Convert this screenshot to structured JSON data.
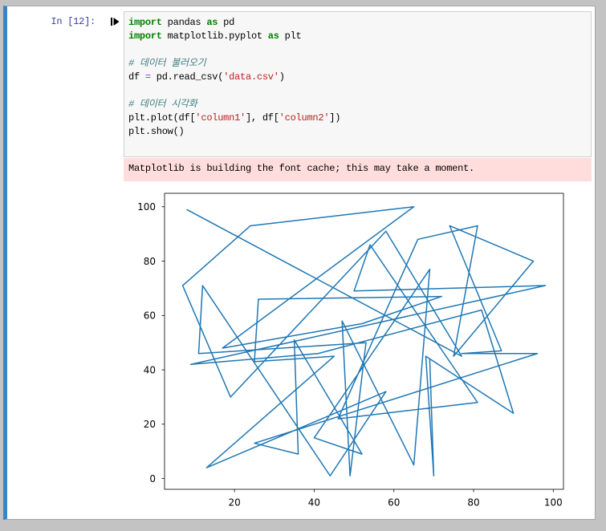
{
  "cell": {
    "prompt": "In [12]:",
    "code_lines": [
      [
        "import",
        " pandas ",
        "as",
        " pd"
      ],
      [
        "import",
        " matplotlib.pyplot ",
        "as",
        " plt"
      ],
      [],
      [
        "# 데이터 불러오기"
      ],
      [
        "df ",
        "=",
        " pd.read_csv(",
        "'data.csv'",
        ")"
      ],
      [],
      [
        "# 데이터 시각화"
      ],
      [
        "plt.plot(df[",
        "'column1'",
        "], df[",
        "'column2'",
        "])"
      ],
      [
        "plt.show()"
      ]
    ],
    "stderr": "Matplotlib is building the font cache; this may take a moment."
  },
  "icons": {
    "run_cell": "run-cell-icon"
  },
  "colors": {
    "selected_cell_bar": "#3a84c6",
    "prompt": "#303f9f",
    "keyword": "#008000",
    "operator": "#aa22ff",
    "string": "#ba2121",
    "comment": "#408080",
    "code_background": "#f7f7f7",
    "stderr_background": "#ffdddd"
  },
  "chart_data": {
    "type": "line",
    "x": [
      8,
      77,
      58,
      19,
      7,
      24,
      65,
      17,
      52,
      72,
      26,
      25,
      45,
      13,
      58,
      44,
      12,
      11,
      53,
      49,
      47,
      65,
      69,
      40,
      52,
      35,
      36,
      25,
      96,
      77,
      87,
      74,
      95,
      75,
      81,
      66,
      46,
      81,
      54,
      50,
      98,
      9,
      41,
      82,
      90,
      68,
      70,
      69
    ],
    "y": [
      99,
      45,
      91,
      30,
      71,
      93,
      100,
      48,
      57,
      67,
      66,
      43,
      45,
      4,
      32,
      1,
      71,
      46,
      50,
      1,
      58,
      5,
      77,
      15,
      9,
      51,
      9,
      13,
      46,
      46,
      47,
      93,
      80,
      45,
      93,
      88,
      22,
      28,
      86,
      69,
      71,
      42,
      46,
      62,
      24,
      45,
      1,
      44
    ],
    "xlim": [
      2.45,
      102.55
    ],
    "ylim": [
      -3.95,
      104.95
    ],
    "x_ticks": [
      20,
      40,
      60,
      80,
      100
    ],
    "y_ticks": [
      0,
      20,
      40,
      60,
      80,
      100
    ],
    "x_tick_labels": [
      "20",
      "40",
      "60",
      "80",
      "100"
    ],
    "y_tick_labels": [
      "0",
      "20",
      "40",
      "60",
      "80",
      "100"
    ],
    "grid": false,
    "legend": "none",
    "line_color": "#1f77b4"
  }
}
